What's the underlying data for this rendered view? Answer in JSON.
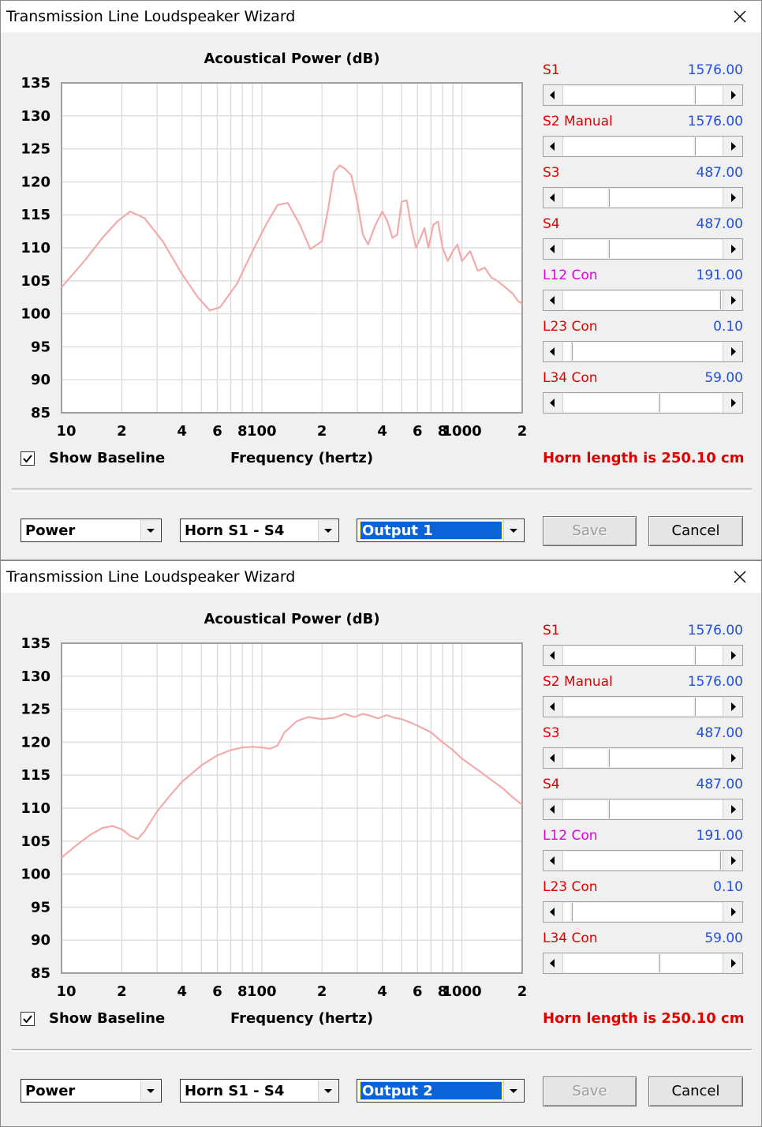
{
  "windows": [
    {
      "title": "Transmission Line Loudspeaker Wizard",
      "chart_title": "Acoustical Power (dB)",
      "show_baseline_label": "Show Baseline",
      "show_baseline_checked": true,
      "frequency_label": "Frequency (hertz)",
      "horn_length": "Horn length is 250.10 cm",
      "combos": {
        "type": "Power",
        "section": "Horn S1 - S4",
        "output": "Output 1"
      },
      "buttons": {
        "save": "Save",
        "cancel": "Cancel"
      },
      "sliders": [
        {
          "label": "S1",
          "value": "1576.00",
          "label_color": "#e00000",
          "position": 0.82
        },
        {
          "label": "S2 Manual",
          "value": "1576.00",
          "label_color": "#e00000",
          "position": 0.82
        },
        {
          "label": "S3",
          "value": "487.00",
          "label_color": "#e00000",
          "position": 0.28
        },
        {
          "label": "S4",
          "value": "487.00",
          "label_color": "#e00000",
          "position": 0.28
        },
        {
          "label": "L12 Con",
          "value": "191.00",
          "label_color": "#e000e0",
          "position": 0.98
        },
        {
          "label": "L23 Con",
          "value": "0.10",
          "label_color": "#e00000",
          "position": 0.05
        },
        {
          "label": "L34 Con",
          "value": "59.00",
          "label_color": "#e00000",
          "position": 0.6
        }
      ]
    },
    {
      "title": "Transmission Line Loudspeaker Wizard",
      "chart_title": "Acoustical Power (dB)",
      "show_baseline_label": "Show Baseline",
      "show_baseline_checked": true,
      "frequency_label": "Frequency (hertz)",
      "horn_length": "Horn length is 250.10 cm",
      "combos": {
        "type": "Power",
        "section": "Horn S1 - S4",
        "output": "Output 2"
      },
      "buttons": {
        "save": "Save",
        "cancel": "Cancel"
      },
      "sliders": [
        {
          "label": "S1",
          "value": "1576.00",
          "label_color": "#e00000",
          "position": 0.82
        },
        {
          "label": "S2 Manual",
          "value": "1576.00",
          "label_color": "#e00000",
          "position": 0.82
        },
        {
          "label": "S3",
          "value": "487.00",
          "label_color": "#e00000",
          "position": 0.28
        },
        {
          "label": "S4",
          "value": "487.00",
          "label_color": "#e00000",
          "position": 0.28
        },
        {
          "label": "L12 Con",
          "value": "191.00",
          "label_color": "#e000e0",
          "position": 0.98
        },
        {
          "label": "L23 Con",
          "value": "0.10",
          "label_color": "#e00000",
          "position": 0.05
        },
        {
          "label": "L34 Con",
          "value": "59.00",
          "label_color": "#e00000",
          "position": 0.6
        }
      ]
    }
  ],
  "colors": {
    "curve": "#f4aaaa",
    "value_blue": "#2050e0",
    "horn_text": "#e00000"
  },
  "chart_data": [
    {
      "type": "line",
      "title": "Acoustical Power (dB)",
      "xlabel": "Frequency (hertz)",
      "ylabel": "",
      "x_scale": "log",
      "xlim": [
        10,
        2000
      ],
      "ylim": [
        85,
        135
      ],
      "x_ticks": [
        10,
        20,
        40,
        60,
        80,
        100,
        200,
        400,
        600,
        800,
        1000,
        2000
      ],
      "x_tick_labels": [
        "10",
        "2",
        "4",
        "6",
        "8",
        "100",
        "2",
        "4",
        "6",
        "8",
        "1000",
        "2"
      ],
      "y_ticks": [
        85,
        90,
        95,
        100,
        105,
        110,
        115,
        120,
        125,
        130,
        135
      ],
      "grid": true,
      "series": [
        {
          "x": [
            10,
            13,
            16,
            19,
            22,
            26,
            32,
            40,
            48,
            55,
            62,
            75,
            90,
            105,
            120,
            135,
            155,
            175,
            200,
            215,
            230,
            245,
            260,
            280,
            300,
            320,
            340,
            370,
            400,
            425,
            450,
            475,
            500,
            530,
            560,
            590,
            620,
            650,
            680,
            720,
            760,
            800,
            850,
            900,
            950,
            1000,
            1100,
            1200,
            1300,
            1400,
            1500,
            1650,
            1800,
            1900,
            2000
          ],
          "y": [
            104,
            108,
            111.5,
            114,
            115.5,
            114.5,
            111,
            106,
            102.5,
            100.5,
            101,
            104.5,
            109.5,
            113.5,
            116.5,
            116.8,
            113.5,
            109.8,
            111,
            116,
            121.5,
            122.5,
            122,
            121,
            117,
            112,
            110.5,
            113.5,
            115.5,
            114,
            111.5,
            112,
            117,
            117.2,
            113,
            110,
            111.5,
            113,
            110,
            113.5,
            114,
            110,
            108,
            109.5,
            110.5,
            108,
            109.5,
            106.5,
            107,
            105.5,
            105,
            104,
            103,
            102,
            101.5
          ]
        }
      ]
    },
    {
      "type": "line",
      "title": "Acoustical Power (dB)",
      "xlabel": "Frequency (hertz)",
      "ylabel": "",
      "x_scale": "log",
      "xlim": [
        10,
        2000
      ],
      "ylim": [
        85,
        135
      ],
      "x_ticks": [
        10,
        20,
        40,
        60,
        80,
        100,
        200,
        400,
        600,
        800,
        1000,
        2000
      ],
      "x_tick_labels": [
        "10",
        "2",
        "4",
        "6",
        "8",
        "100",
        "2",
        "4",
        "6",
        "8",
        "1000",
        "2"
      ],
      "y_ticks": [
        85,
        90,
        95,
        100,
        105,
        110,
        115,
        120,
        125,
        130,
        135
      ],
      "grid": true,
      "series": [
        {
          "x": [
            10,
            12,
            14,
            16,
            18,
            20,
            22,
            24,
            26,
            30,
            35,
            40,
            50,
            60,
            70,
            80,
            90,
            100,
            110,
            120,
            130,
            150,
            170,
            200,
            230,
            260,
            290,
            320,
            350,
            380,
            420,
            460,
            500,
            550,
            600,
            700,
            800,
            900,
            1000,
            1200,
            1400,
            1600,
            1800,
            2000
          ],
          "y": [
            102.5,
            104.5,
            106,
            107,
            107.3,
            106.8,
            105.8,
            105.3,
            106.5,
            109.5,
            112,
            114,
            116.5,
            118,
            118.8,
            119.2,
            119.3,
            119.2,
            119,
            119.5,
            121.5,
            123.2,
            123.8,
            123.5,
            123.7,
            124.3,
            123.8,
            124.3,
            124,
            123.6,
            124.1,
            123.7,
            123.5,
            123,
            122.5,
            121.5,
            120,
            118.8,
            117.5,
            115.8,
            114.3,
            113,
            111.6,
            110.5
          ]
        }
      ]
    }
  ]
}
